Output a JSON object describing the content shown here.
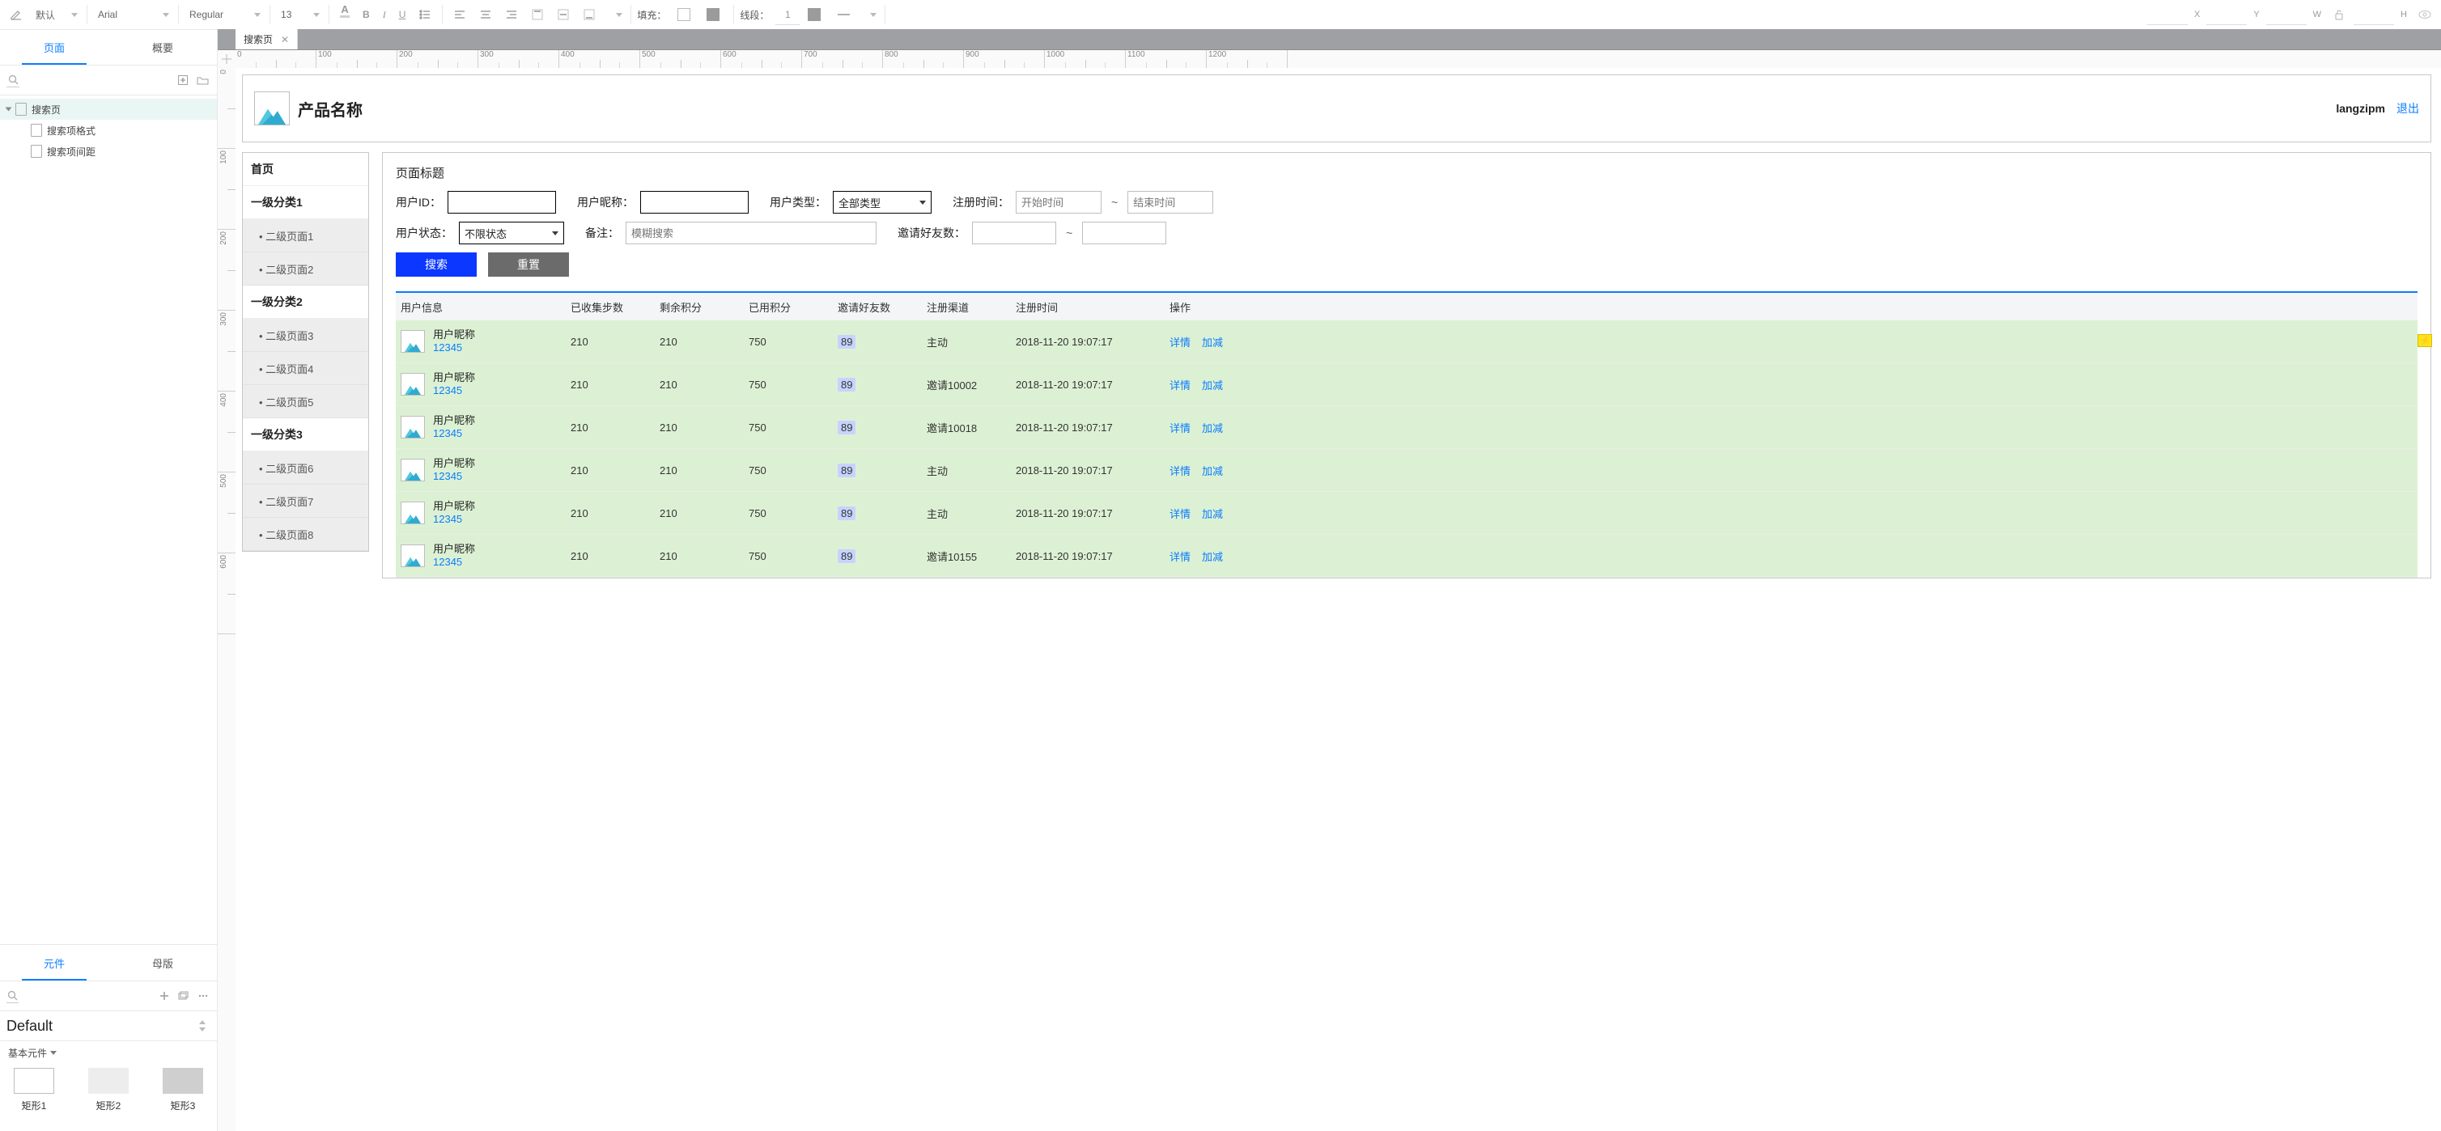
{
  "toolbar": {
    "style_dropdown": "默认",
    "font_family": "Arial",
    "font_weight": "Regular",
    "font_size": "13",
    "fill_label": "填充：",
    "line_label": "线段：",
    "line_width": "1",
    "pos_x_label": "X",
    "pos_y_label": "Y",
    "pos_w_label": "W",
    "pos_h_label": "H"
  },
  "left": {
    "tabs": [
      "页面",
      "概要"
    ],
    "tree": {
      "root": "搜索页",
      "children": [
        "搜索项格式",
        "搜索项间距"
      ]
    },
    "bottom_tabs": [
      "元件",
      "母版"
    ],
    "library_select": "Default",
    "library_label": "基本元件",
    "shapes": [
      "矩形1",
      "矩形2",
      "矩形3"
    ]
  },
  "doc_tab": {
    "title": "搜索页"
  },
  "ruler": {
    "h": [
      "0",
      "100",
      "200",
      "300",
      "400",
      "500",
      "600",
      "700",
      "800",
      "900",
      "1000",
      "1100",
      "1200"
    ],
    "v": [
      "0",
      "100",
      "200",
      "300",
      "400",
      "500",
      "600"
    ]
  },
  "pageHeader": {
    "product_title": "产品名称",
    "username": "langzipm",
    "logout": "退出"
  },
  "sidebar": {
    "home": "首页",
    "groups": [
      {
        "title": "一级分类1",
        "items": [
          "二级页面1",
          "二级页面2"
        ]
      },
      {
        "title": "一级分类2",
        "items": [
          "二级页面3",
          "二级页面4",
          "二级页面5"
        ]
      },
      {
        "title": "一级分类3",
        "items": [
          "二级页面6",
          "二级页面7",
          "二级页面8"
        ]
      }
    ]
  },
  "content": {
    "title": "页面标题",
    "filters": {
      "user_id_label": "用户ID：",
      "nickname_label": "用户昵称：",
      "user_type_label": "用户类型：",
      "user_type_value": "全部类型",
      "reg_time_label": "注册时间：",
      "reg_time_start_ph": "开始时间",
      "reg_time_end_ph": "结束时间",
      "user_state_label": "用户状态：",
      "user_state_value": "不限状态",
      "remark_label": "备注：",
      "remark_ph": "模糊搜索",
      "invite_label": "邀请好友数：",
      "tilde": "~",
      "search_btn": "搜索",
      "reset_btn": "重置"
    },
    "columns": [
      "用户信息",
      "已收集步数",
      "剩余积分",
      "已用积分",
      "邀请好友数",
      "注册渠道",
      "注册时间",
      "操作"
    ],
    "actions": {
      "detail": "详情",
      "adjust": "加减"
    },
    "rows": [
      {
        "nickname": "用户昵称",
        "uid": "12345",
        "steps": "210",
        "remain": "210",
        "used": "750",
        "invite": "89",
        "channel": "主动",
        "time": "2018-11-20 19:07:17"
      },
      {
        "nickname": "用户昵称",
        "uid": "12345",
        "steps": "210",
        "remain": "210",
        "used": "750",
        "invite": "89",
        "channel": "邀请10002",
        "time": "2018-11-20 19:07:17"
      },
      {
        "nickname": "用户昵称",
        "uid": "12345",
        "steps": "210",
        "remain": "210",
        "used": "750",
        "invite": "89",
        "channel": "邀请10018",
        "time": "2018-11-20 19:07:17"
      },
      {
        "nickname": "用户昵称",
        "uid": "12345",
        "steps": "210",
        "remain": "210",
        "used": "750",
        "invite": "89",
        "channel": "主动",
        "time": "2018-11-20 19:07:17"
      },
      {
        "nickname": "用户昵称",
        "uid": "12345",
        "steps": "210",
        "remain": "210",
        "used": "750",
        "invite": "89",
        "channel": "主动",
        "time": "2018-11-20 19:07:17"
      },
      {
        "nickname": "用户昵称",
        "uid": "12345",
        "steps": "210",
        "remain": "210",
        "used": "750",
        "invite": "89",
        "channel": "邀请10155",
        "time": "2018-11-20 19:07:17"
      }
    ]
  }
}
